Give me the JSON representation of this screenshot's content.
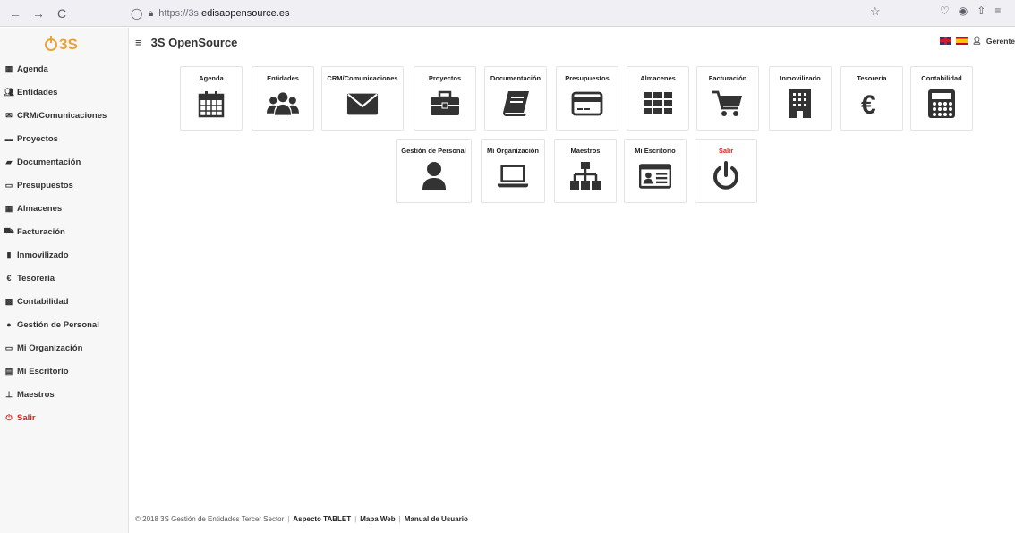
{
  "browser": {
    "url_prefix": "https://3s.",
    "url_host": "edisaopensource.es",
    "back": "←",
    "forward": "→",
    "reload": "C"
  },
  "app": {
    "logo": "ⴰ3S",
    "title": "3S OpenSource",
    "user": "Gerente"
  },
  "sidebar": {
    "items": [
      {
        "label": "Agenda"
      },
      {
        "label": "Entidades"
      },
      {
        "label": "CRM/Comunicaciones"
      },
      {
        "label": "Proyectos"
      },
      {
        "label": "Documentación"
      },
      {
        "label": "Presupuestos"
      },
      {
        "label": "Almacenes"
      },
      {
        "label": "Facturación"
      },
      {
        "label": "Inmovilizado"
      },
      {
        "label": "Tesorería"
      },
      {
        "label": "Contabilidad"
      },
      {
        "label": "Gestión de Personal"
      },
      {
        "label": "Mi Organización"
      },
      {
        "label": "Mi Escritorio"
      },
      {
        "label": "Maestros"
      },
      {
        "label": "Salir"
      }
    ]
  },
  "tiles": {
    "row1": [
      {
        "label": "Agenda"
      },
      {
        "label": "Entidades"
      },
      {
        "label": "CRM/Comunicaciones"
      },
      {
        "label": "Proyectos"
      },
      {
        "label": "Documentación"
      },
      {
        "label": "Presupuestos"
      },
      {
        "label": "Almacenes"
      },
      {
        "label": "Facturación"
      },
      {
        "label": "Inmovilizado"
      },
      {
        "label": "Tesorería"
      },
      {
        "label": "Contabilidad"
      }
    ],
    "row2": [
      {
        "label": "Gestión de Personal"
      },
      {
        "label": "Mi Organización"
      },
      {
        "label": "Maestros"
      },
      {
        "label": "Mi Escritorio"
      },
      {
        "label": "Salir"
      }
    ]
  },
  "footer": {
    "copyright": "© 2018 3S Gestión de Entidades Tercer Sector",
    "link1": "Aspecto TABLET",
    "link2": "Mapa Web",
    "link3": "Manual de Usuario"
  },
  "colors": {
    "accent_exit": "#e02020",
    "logo": "#e8a33a",
    "icon": "#333333"
  }
}
